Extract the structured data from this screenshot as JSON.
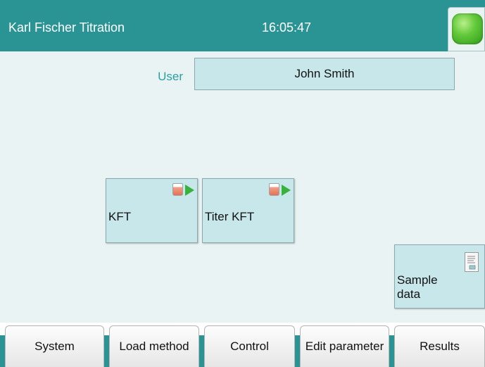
{
  "header": {
    "title": "Karl Fischer Titration",
    "clock": "16:05:47",
    "status_color": "#5cc43a"
  },
  "user": {
    "label": "User",
    "value": "John Smith"
  },
  "methods": [
    {
      "label": "KFT",
      "icon": "beaker-start-icon"
    },
    {
      "label": "Titer KFT",
      "icon": "beaker-start-icon"
    }
  ],
  "sample_data": {
    "label": "Sample data",
    "icon": "document-icon"
  },
  "tabs": [
    {
      "label": "System"
    },
    {
      "label": "Load method"
    },
    {
      "label": "Control"
    },
    {
      "label": "Edit parameter"
    },
    {
      "label": "Results"
    }
  ],
  "colors": {
    "accent": "#2a9393",
    "tile_fill": "#c7e7eb",
    "background": "#eaf3f3"
  }
}
